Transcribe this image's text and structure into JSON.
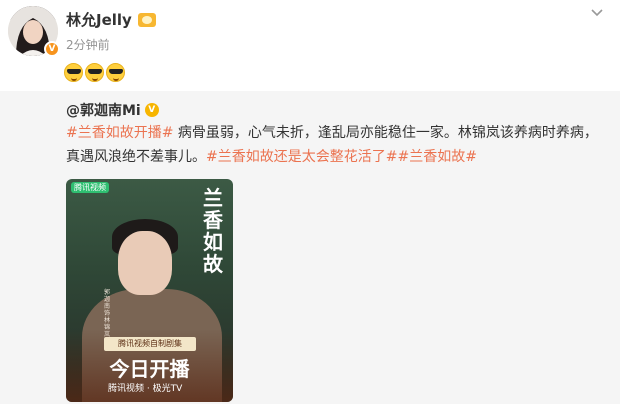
{
  "post": {
    "author": "林允Jelly",
    "time": "2分钟前",
    "emoji_count": 3,
    "emoji_name": "sunglasses-emoji"
  },
  "repost": {
    "author": "@郭迦南Mi",
    "text_parts": [
      {
        "type": "topic",
        "text": "#兰香如故开播#"
      },
      {
        "type": "text",
        "text": " 病骨虽弱，心气未折，逢乱局亦能稳住一家。林锦岚该养病时养病，真遇风浪绝不差事儿。"
      },
      {
        "type": "topic",
        "text": "#兰香如故还是太会整花活了#"
      },
      {
        "type": "topic",
        "text": "#兰香如故#"
      }
    ],
    "image": {
      "title": "兰香如故",
      "platform_tag": "腾讯视频",
      "banner": "腾讯视频自制剧集",
      "big_text": "今日开播",
      "sponsors": "腾讯视频 · 极光TV",
      "vertical_text": "郭迦南饰林锦岚"
    }
  },
  "colors": {
    "topic": "#eb7350",
    "username": "#333333",
    "timestamp": "#939393",
    "repost_bg": "#f5f5f5",
    "verify": "#f7941d",
    "gold_badge": "#f7b500"
  }
}
